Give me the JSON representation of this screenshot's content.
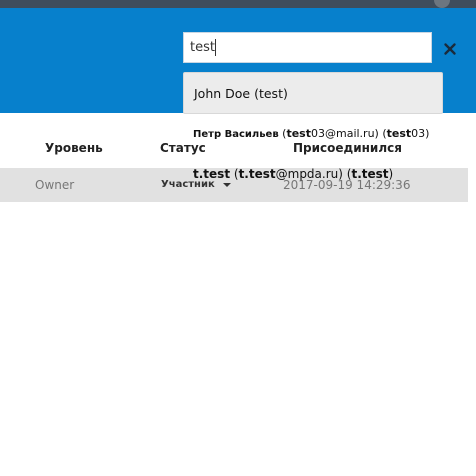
{
  "search": {
    "value": "test"
  },
  "table": {
    "headers": [
      "Уровень",
      "Статус",
      "Присоединился"
    ],
    "rows": [
      {
        "level": "Owner",
        "status": "Участник",
        "joined": "2017-09-19 14:29:36"
      }
    ]
  },
  "suggestions": [
    {
      "text": "John Doe (test)"
    },
    {
      "name": "Петр Васильев",
      "open1": " (",
      "bold1": "test",
      "email_rest": "03@mail.ru",
      "mid": ") (",
      "bold2": "test",
      "tail": "03)"
    },
    {
      "bold1": "t.test",
      "open": " (",
      "bold2": "t.test",
      "email_rest": "@mpda.ru",
      "mid": ") (",
      "bold3": "t.test",
      "tail": ")"
    }
  ],
  "icons": {
    "clear": "close-icon",
    "status_dropdown": "caret-down-icon"
  },
  "colors": {
    "header_bg": "#0780cc",
    "row_bg": "#e1e1e1",
    "top_strip": "#3f4d5c"
  }
}
